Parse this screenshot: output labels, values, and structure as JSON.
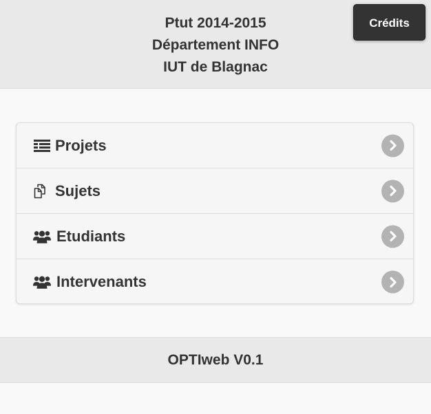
{
  "header": {
    "title_lines": [
      "Ptut 2014-2015",
      "Département INFO",
      "IUT de Blagnac"
    ]
  },
  "credits_button": {
    "label": "Crédits"
  },
  "nav": {
    "items": [
      {
        "label": "Projets",
        "icon": "list-icon"
      },
      {
        "label": "Sujets",
        "icon": "copy-icon"
      },
      {
        "label": "Etudiants",
        "icon": "users-icon"
      },
      {
        "label": "Intervenants",
        "icon": "users-icon"
      }
    ]
  },
  "footer": {
    "text": "OPTIweb V0.1"
  },
  "colors": {
    "header_bg": "#e9e9e9",
    "button_bg": "#333333",
    "text": "#333333",
    "chevron_bg": "#b3b3b3"
  }
}
